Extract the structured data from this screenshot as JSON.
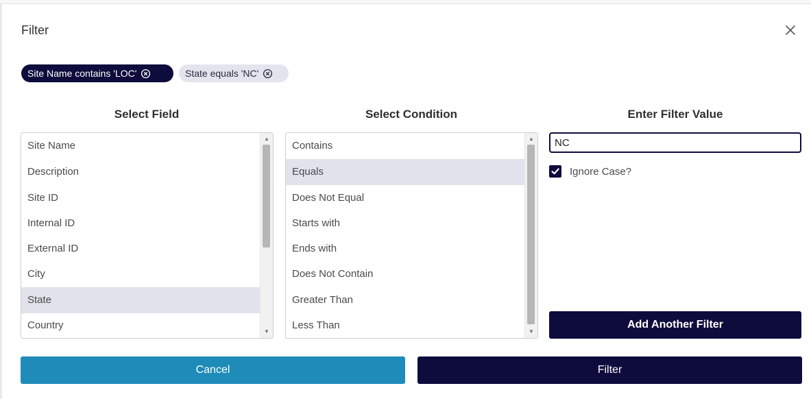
{
  "dialog": {
    "title": "Filter",
    "close_icon": "close-icon"
  },
  "chips": [
    {
      "label": "Site Name contains 'LOC'",
      "active": true,
      "remove_icon": "circle-x-icon"
    },
    {
      "label": "State equals 'NC'",
      "active": false,
      "remove_icon": "circle-x-icon"
    }
  ],
  "field_column": {
    "heading": "Select Field",
    "items": [
      "Site Name",
      "Description",
      "Site ID",
      "Internal ID",
      "External ID",
      "City",
      "State",
      "Country"
    ],
    "selected": "State"
  },
  "condition_column": {
    "heading": "Select Condition",
    "items": [
      "Contains",
      "Equals",
      "Does Not Equal",
      "Starts with",
      "Ends with",
      "Does Not Contain",
      "Greater Than",
      "Less Than"
    ],
    "selected": "Equals"
  },
  "value_column": {
    "heading": "Enter Filter Value",
    "value": "NC",
    "ignore_case_label": "Ignore Case?",
    "ignore_case_checked": true,
    "add_label": "Add Another Filter"
  },
  "footer": {
    "cancel_label": "Cancel",
    "filter_label": "Filter"
  },
  "colors": {
    "primary": "#0d0c3c",
    "cancel": "#1f8bb9",
    "selected_row": "#e1e2ec"
  }
}
